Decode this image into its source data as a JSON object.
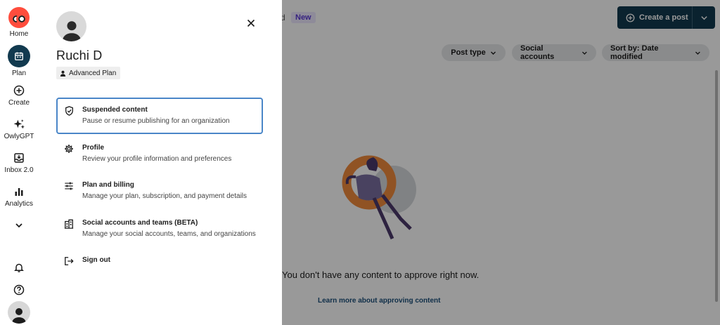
{
  "rail": {
    "items": [
      {
        "label": "Home",
        "icon": "owl-logo-icon"
      },
      {
        "label": "Plan",
        "icon": "calendar-icon"
      },
      {
        "label": "Create",
        "icon": "plus-circle-icon"
      },
      {
        "label": "OwlyGPT",
        "icon": "sparkle-icon"
      },
      {
        "label": "Inbox 2.0",
        "icon": "inbox-icon"
      },
      {
        "label": "Analytics",
        "icon": "bar-chart-icon"
      }
    ],
    "accent_color": "#123a4f",
    "brand_color": "#ff4d3d"
  },
  "drawer": {
    "user_name": "Ruchi D",
    "plan_label": "Advanced Plan",
    "menu": [
      {
        "title": "Suspended content",
        "description": "Pause or resume publishing for an organization",
        "icon": "shield-check-icon"
      },
      {
        "title": "Profile",
        "description": "Review your profile information and preferences",
        "icon": "gear-icon"
      },
      {
        "title": "Plan and billing",
        "description": "Manage your plan, subscription, and payment details",
        "icon": "sliders-icon"
      },
      {
        "title": "Social accounts and teams (BETA)",
        "description": "Manage your social accounts, teams, and organizations",
        "icon": "building-icon"
      },
      {
        "title": "Sign out",
        "description": "",
        "icon": "sign-out-icon"
      }
    ]
  },
  "background": {
    "tab_fragment": "d",
    "new_badge": "New",
    "create_post_label": "Create a post",
    "filters": [
      "Post type",
      "Social accounts",
      "Sort by: Date modified"
    ],
    "empty_message": "You don't have any content to approve right now.",
    "learn_more_link": "Learn more about approving content"
  }
}
